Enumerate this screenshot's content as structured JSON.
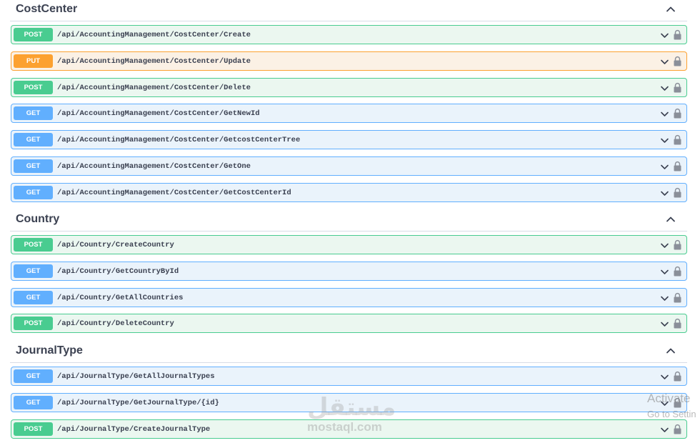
{
  "sections": [
    {
      "title": "CostCenter",
      "expanded": true,
      "operations": [
        {
          "method": "POST",
          "path": "/api/AccountingManagement/CostCenter/Create"
        },
        {
          "method": "PUT",
          "path": "/api/AccountingManagement/CostCenter/Update"
        },
        {
          "method": "POST",
          "path": "/api/AccountingManagement/CostCenter/Delete"
        },
        {
          "method": "GET",
          "path": "/api/AccountingManagement/CostCenter/GetNewId"
        },
        {
          "method": "GET",
          "path": "/api/AccountingManagement/CostCenter/GetcostCenterTree"
        },
        {
          "method": "GET",
          "path": "/api/AccountingManagement/CostCenter/GetOne"
        },
        {
          "method": "GET",
          "path": "/api/AccountingManagement/CostCenter/GetCostCenterId"
        }
      ]
    },
    {
      "title": "Country",
      "expanded": true,
      "operations": [
        {
          "method": "POST",
          "path": "/api/Country/CreateCountry"
        },
        {
          "method": "GET",
          "path": "/api/Country/GetCountryById"
        },
        {
          "method": "GET",
          "path": "/api/Country/GetAllCountries"
        },
        {
          "method": "POST",
          "path": "/api/Country/DeleteCountry"
        }
      ]
    },
    {
      "title": "JournalType",
      "expanded": true,
      "operations": [
        {
          "method": "GET",
          "path": "/api/JournalType/GetAllJournalTypes"
        },
        {
          "method": "GET",
          "path": "/api/JournalType/GetJournalType/{id}"
        },
        {
          "method": "POST",
          "path": "/api/JournalType/CreateJournalType"
        }
      ]
    }
  ],
  "icons": {
    "section_toggle": "chevron-up-icon",
    "operation_toggle": "chevron-down-icon",
    "auth": "lock-icon"
  },
  "colors": {
    "post": "#49cc90",
    "put": "#fca130",
    "get": "#61affe",
    "text": "#3b4151"
  },
  "watermark": {
    "logo": "مستقل",
    "site": "mostaql.com"
  },
  "activation": {
    "title": "Activate",
    "subtitle": "Go to Settin"
  }
}
